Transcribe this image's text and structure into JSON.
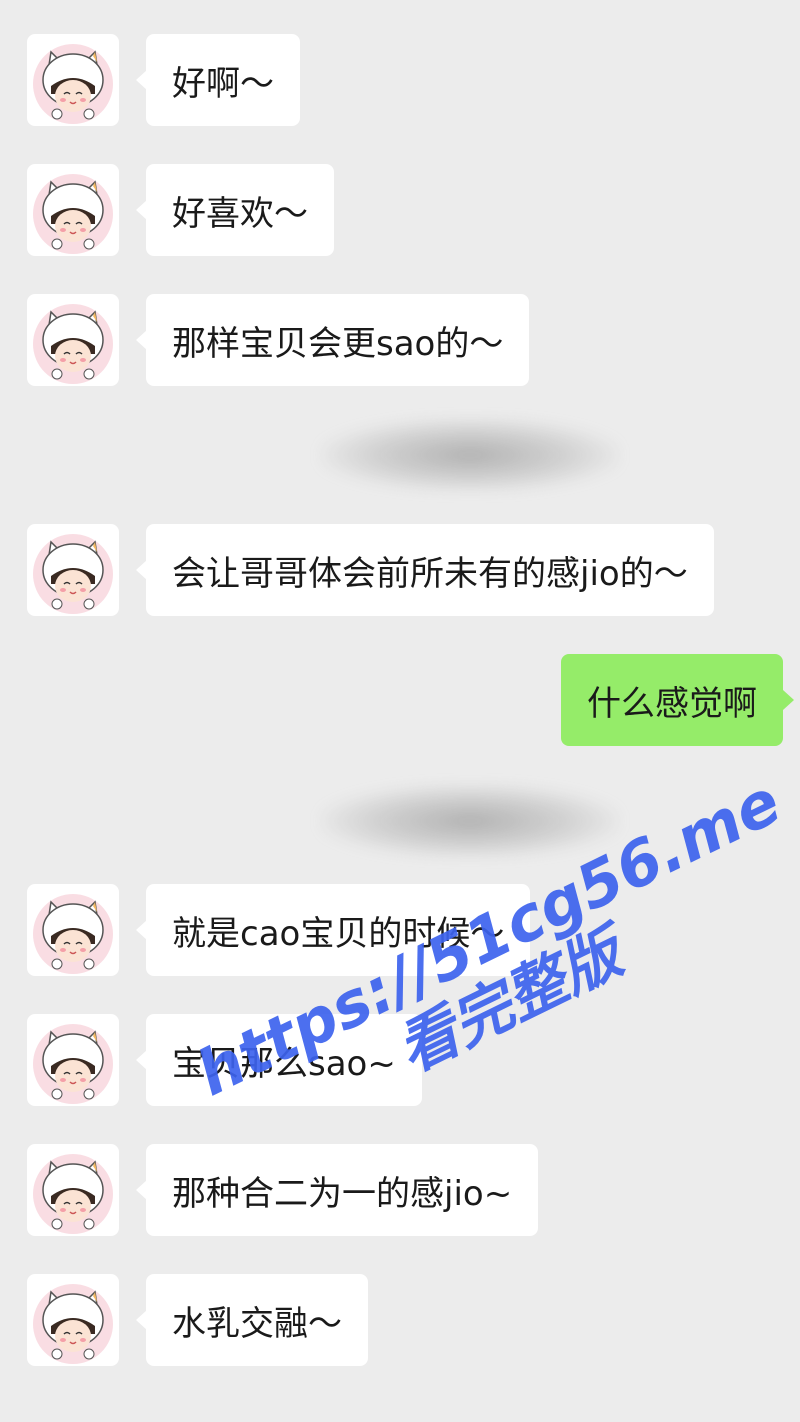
{
  "messages": [
    {
      "side": "in",
      "text": "好啊～"
    },
    {
      "side": "in",
      "text": "好喜欢～"
    },
    {
      "side": "in",
      "text": "那样宝贝会更sao的～"
    },
    {
      "side": "in",
      "text": "会让哥哥体会前所未有的感jio的～"
    },
    {
      "side": "out",
      "text": "什么感觉啊"
    },
    {
      "side": "in",
      "text": "就是cao宝贝的时候～"
    },
    {
      "side": "in",
      "text": "宝贝那么sao~"
    },
    {
      "side": "in",
      "text": "那种合二为一的感jio~"
    },
    {
      "side": "in",
      "text": "水乳交融～"
    }
  ],
  "avatar_icon": "cat-hat-girl-avatar-icon",
  "colors": {
    "background": "#ececec",
    "incoming_bubble": "#ffffff",
    "outgoing_bubble": "#95ec69",
    "watermark": "#3d63ee"
  },
  "watermark": {
    "url": "https://51cg56.me",
    "subtitle": "看完整版"
  }
}
